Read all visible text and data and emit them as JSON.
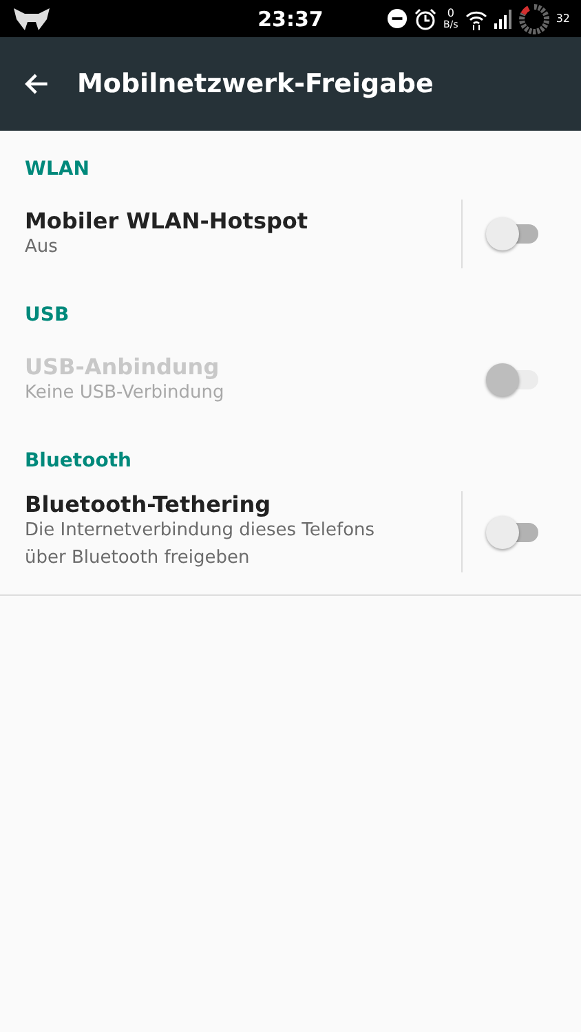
{
  "status_bar": {
    "time": "23:37",
    "speed_value": "0",
    "speed_unit": "B/s",
    "battery": "32"
  },
  "toolbar": {
    "title": "Mobilnetzwerk-Freigabe"
  },
  "sections": [
    {
      "header": "WLAN",
      "items": [
        {
          "title": "Mobiler WLAN-Hotspot",
          "summary": [
            "Aus"
          ],
          "disabled": false,
          "on": false,
          "has_settings": true
        }
      ]
    },
    {
      "header": "USB",
      "items": [
        {
          "title": "USB-Anbindung",
          "summary": [
            "Keine USB-Verbindung"
          ],
          "disabled": true,
          "on": false,
          "has_settings": false
        }
      ]
    },
    {
      "header": "Bluetooth",
      "items": [
        {
          "title": "Bluetooth-Tethering",
          "summary": [
            "Die Internetverbindung dieses Telefons",
            "über Bluetooth freigeben"
          ],
          "disabled": false,
          "on": false,
          "has_settings": true
        }
      ]
    }
  ]
}
